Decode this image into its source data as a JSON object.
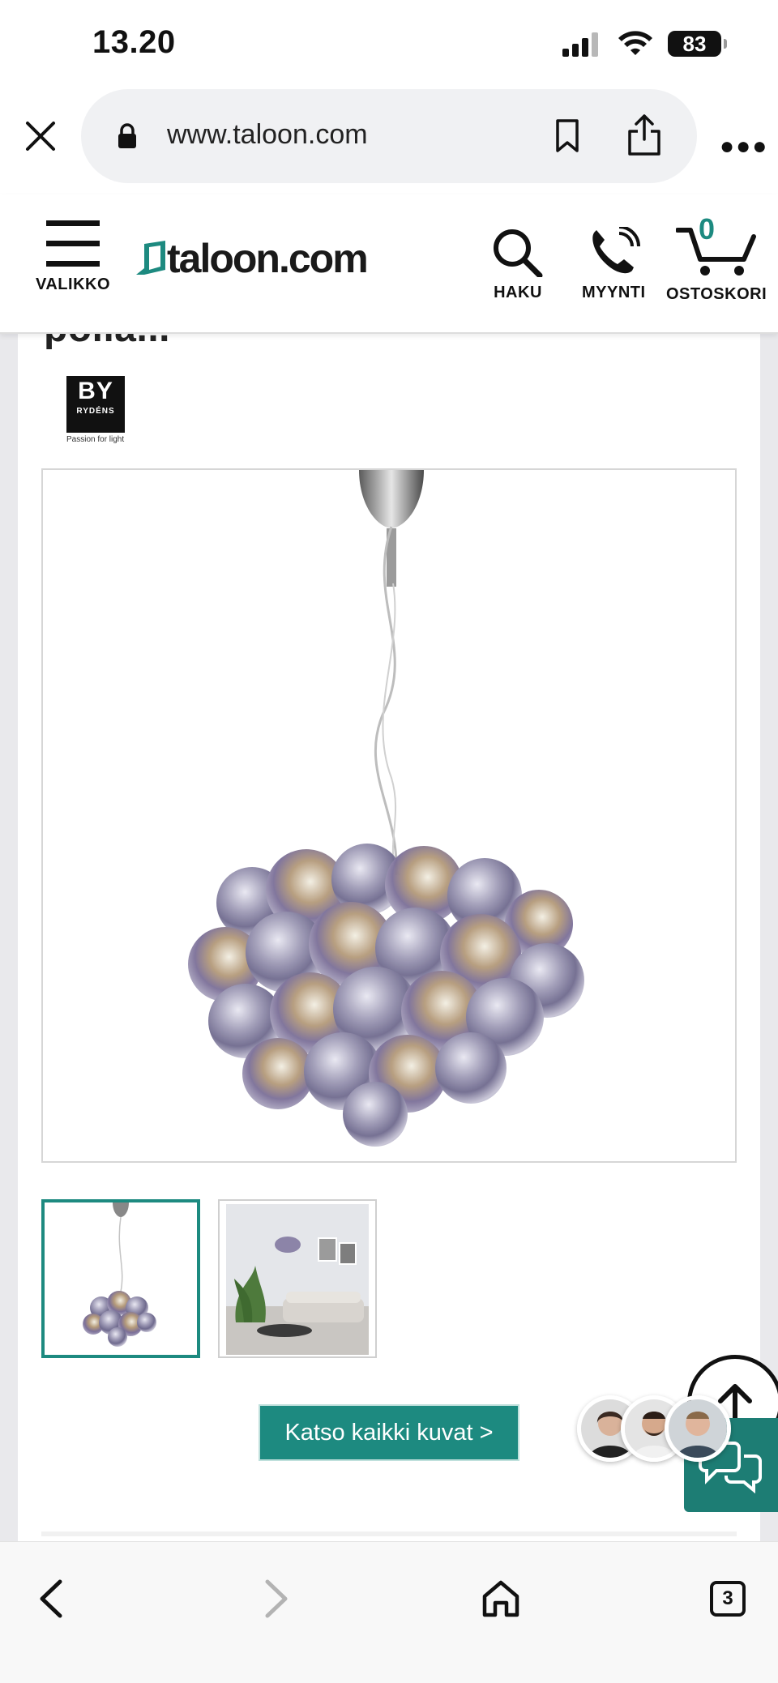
{
  "status": {
    "time": "13.20",
    "battery": "83"
  },
  "browser": {
    "url": "www.taloon.com"
  },
  "header": {
    "menu_label": "VALIKKO",
    "logo_text": "taloon.com",
    "search_label": "HAKU",
    "sales_label": "MYYNTI",
    "cart_label": "OSTOSKORI",
    "cart_count": "0"
  },
  "product": {
    "title_fragment": "pöllä...",
    "brand": {
      "mark": "BY",
      "name": "RYDÉNS",
      "tagline": "Passion for light"
    },
    "view_all_label": "Katso kaikki kuvat >"
  },
  "bottom_nav": {
    "tabs_count": "3"
  },
  "colors": {
    "accent": "#1d8a80",
    "chat_bg": "#1d7d74"
  }
}
